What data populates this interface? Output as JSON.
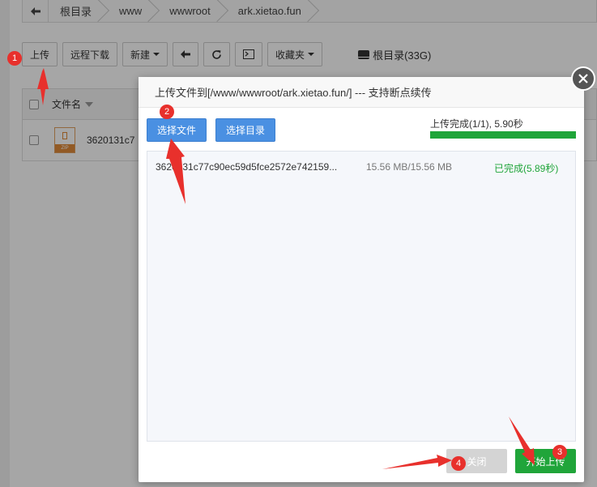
{
  "breadcrumb": {
    "items": [
      "根目录",
      "www",
      "wwwroot",
      "ark.xietao.fun"
    ]
  },
  "toolbar": {
    "upload_label": "上传",
    "remote_download_label": "远程下载",
    "new_label": "新建",
    "favorites_label": "收藏夹",
    "disk_label": "根目录(33G)"
  },
  "file_table": {
    "name_header": "文件名",
    "rows": [
      {
        "name": "3620131c7",
        "icon_text": "ZIP"
      }
    ]
  },
  "upload_dialog": {
    "title": "上传文件到[/www/wwwroot/ark.xietao.fun/] --- 支持断点续传",
    "select_file_label": "选择文件",
    "select_dir_label": "选择目录",
    "status_text": "上传完成(1/1), 5.90秒",
    "progress_fraction": 1.0,
    "files": [
      {
        "name": "3620131c77c90ec59d5fce2572e742159...",
        "size": "15.56 MB/15.56 MB",
        "status": "已完成(5.89秒)"
      }
    ],
    "close_label": "关闭",
    "start_label": "开始上传"
  },
  "annotations": {
    "badges": [
      "1",
      "2",
      "3",
      "4"
    ]
  },
  "colors": {
    "primary_blue": "#4a90e2",
    "success_green": "#20a53a",
    "annotation_red": "#e8302c"
  }
}
